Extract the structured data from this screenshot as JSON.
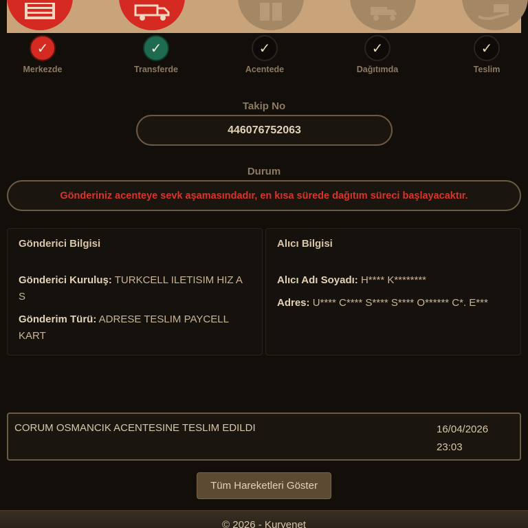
{
  "steps": [
    {
      "label": "Merkezde",
      "state": "done-red",
      "icon": "warehouse-icon"
    },
    {
      "label": "Transferde",
      "state": "done-green",
      "icon": "truck-icon"
    },
    {
      "label": "Acentede",
      "state": "pending",
      "icon": "package-icon"
    },
    {
      "label": "Dağıtımda",
      "state": "pending",
      "icon": "delivery-vehicle-icon"
    },
    {
      "label": "Teslim",
      "state": "pending",
      "icon": "hand-package-icon"
    }
  ],
  "check_glyph": "✓",
  "tracking": {
    "label": "Takip No",
    "value": "446076752063"
  },
  "status": {
    "label": "Durum",
    "message": "Gönderiniz acenteye sevk aşamasındadır, en kısa sürede dağıtım süreci başlayacaktır."
  },
  "sender": {
    "title": "Gönderici Bilgisi",
    "org_label": "Gönderici Kuruluş:",
    "org_value": "TURKCELL ILETISIM HIZ A S",
    "type_label": "Gönderim Türü:",
    "type_value": "ADRESE TESLIM PAYCELL KART"
  },
  "receiver": {
    "title": "Alıcı Bilgisi",
    "name_label": "Alıcı Adı Soyadı:",
    "name_value": "H**** K********",
    "address_label": "Adres:",
    "address_value": "U**** C**** S**** S**** O****** C*. E***"
  },
  "movement": {
    "text": "CORUM OSMANCIK ACENTESINE TESLIM EDILDI",
    "date": "16/04/2026",
    "time": "23:03"
  },
  "show_all_button": "Tüm Hareketleri Göster",
  "footer": "© 2026 - Kuryenet",
  "colors": {
    "red": "#d42a22",
    "green": "#1f6b52",
    "banner": "#c9a47a",
    "background": "#120e0a"
  }
}
